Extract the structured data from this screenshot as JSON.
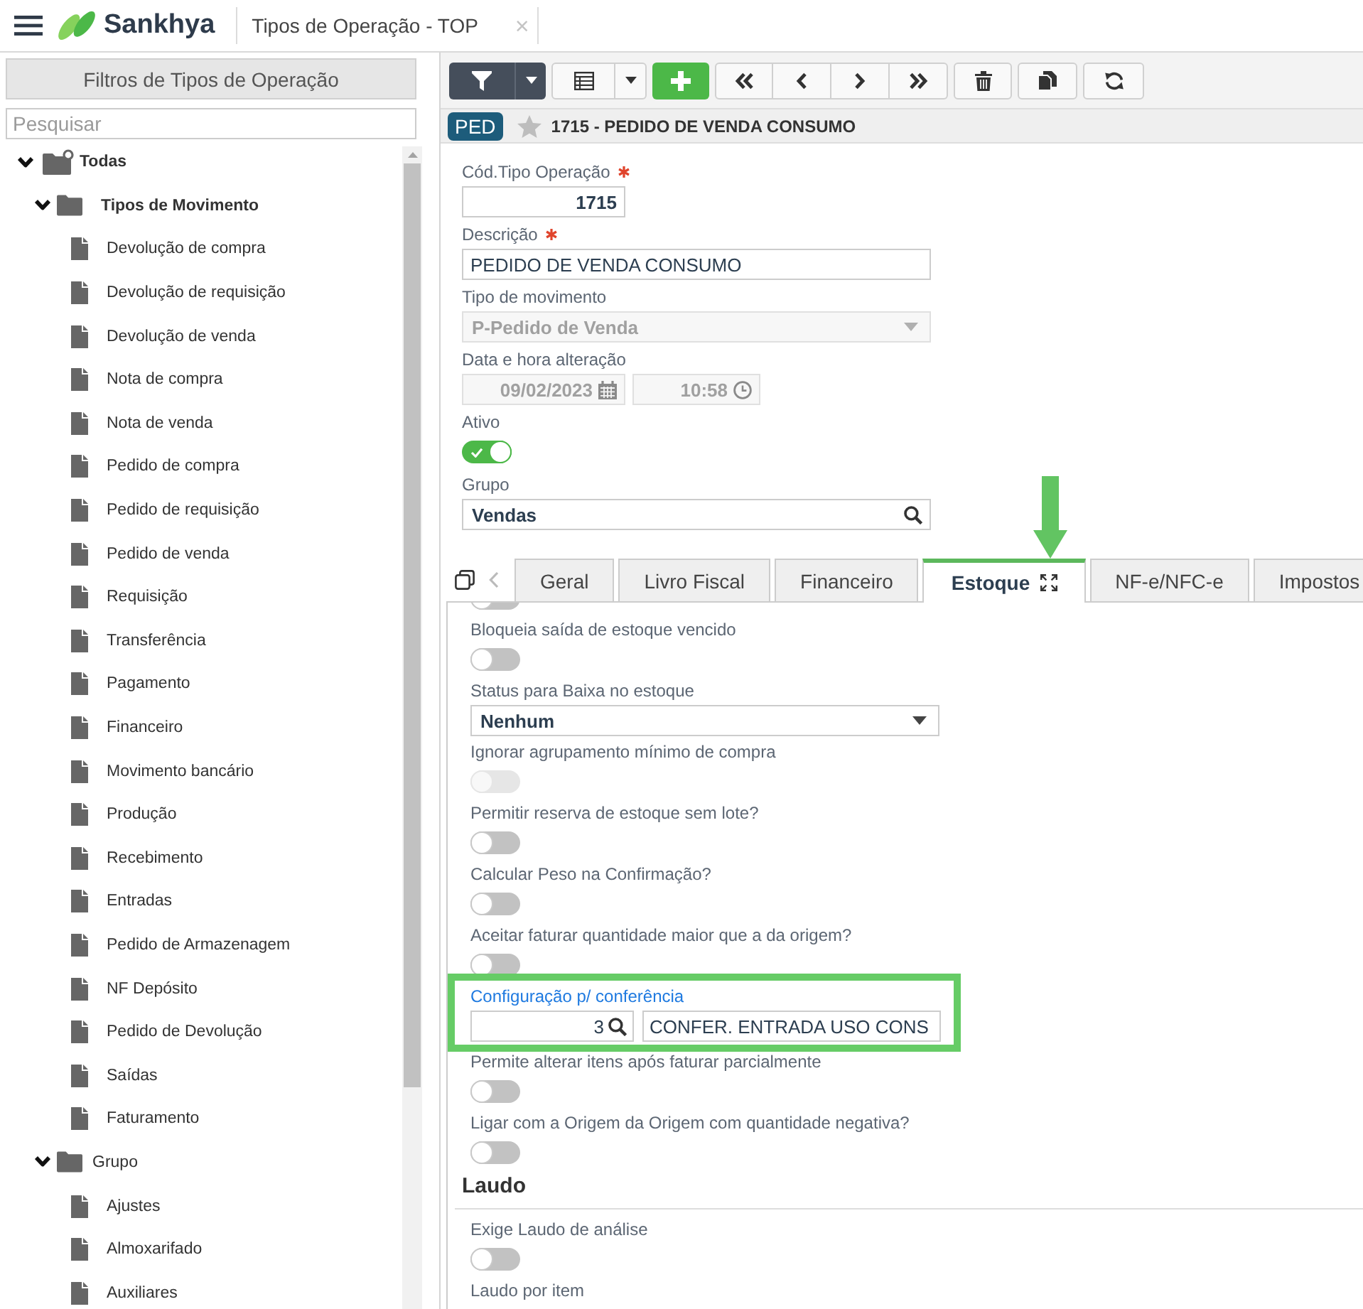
{
  "header": {
    "brand": "Sankhya",
    "tab_title": "Tipos de Operação - TOP",
    "close": "×"
  },
  "sidebar": {
    "title": "Filtros de Tipos de Operação",
    "search": {
      "placeholder": "Pesquisar"
    },
    "tree": [
      {
        "label": "Todas",
        "kind": "root",
        "expanded": true,
        "selected": false,
        "children": [
          {
            "label": "Tipos de Movimento",
            "kind": "folder",
            "expanded": true,
            "selected": true,
            "children": [
              {
                "label": "Devolução de compra",
                "kind": "file",
                "selected": false
              },
              {
                "label": "Devolução de requisição",
                "kind": "file",
                "selected": false
              },
              {
                "label": "Devolução de venda",
                "kind": "file",
                "selected": false
              },
              {
                "label": "Nota de compra",
                "kind": "file",
                "selected": false
              },
              {
                "label": "Nota de venda",
                "kind": "file",
                "selected": false
              },
              {
                "label": "Pedido de compra",
                "kind": "file",
                "selected": false
              },
              {
                "label": "Pedido de requisição",
                "kind": "file",
                "selected": false
              },
              {
                "label": "Pedido de venda",
                "kind": "file",
                "selected": false
              },
              {
                "label": "Requisição",
                "kind": "file",
                "selected": false
              },
              {
                "label": "Transferência",
                "kind": "file",
                "selected": false
              },
              {
                "label": "Pagamento",
                "kind": "file",
                "selected": false
              },
              {
                "label": "Financeiro",
                "kind": "file",
                "selected": false
              },
              {
                "label": "Movimento bancário",
                "kind": "file",
                "selected": false
              },
              {
                "label": "Produção",
                "kind": "file",
                "selected": false
              },
              {
                "label": "Recebimento",
                "kind": "file",
                "selected": false
              },
              {
                "label": "Entradas",
                "kind": "file",
                "selected": false
              },
              {
                "label": "Pedido de Armazenagem",
                "kind": "file",
                "selected": false
              },
              {
                "label": "NF Depósito",
                "kind": "file",
                "selected": false
              },
              {
                "label": "Pedido de Devolução",
                "kind": "file",
                "selected": false
              },
              {
                "label": "Saídas",
                "kind": "file",
                "selected": false
              },
              {
                "label": "Faturamento",
                "kind": "file",
                "selected": false
              }
            ]
          },
          {
            "label": "Grupo",
            "kind": "folder",
            "expanded": true,
            "selected": false,
            "children": [
              {
                "label": "Ajustes",
                "kind": "file",
                "selected": false
              },
              {
                "label": "Almoxarifado",
                "kind": "file",
                "selected": false
              },
              {
                "label": "Auxiliares",
                "kind": "file",
                "selected": false
              }
            ]
          }
        ]
      }
    ]
  },
  "record": {
    "badge": "PED",
    "favorite": false,
    "title": "1715 - PEDIDO DE VENDA CONSUMO"
  },
  "form": {
    "fields": [
      {
        "kind": "number",
        "label": "Cód.Tipo Operação",
        "required": true,
        "disabled": false,
        "value": "1715"
      },
      {
        "kind": "text",
        "label": "Descrição",
        "required": true,
        "disabled": false,
        "value": "PEDIDO DE VENDA CONSUMO"
      },
      {
        "kind": "select",
        "label": "Tipo de movimento",
        "required": false,
        "disabled": true,
        "value": "P-Pedido de Venda"
      },
      {
        "kind": "datetime",
        "label": "Data e hora alteração",
        "required": false,
        "disabled": true,
        "date": "09/02/2023",
        "time": "10:58"
      },
      {
        "kind": "toggle",
        "label": "Ativo",
        "required": false,
        "disabled": false,
        "on": true
      },
      {
        "kind": "lookup",
        "label": "Grupo",
        "required": false,
        "disabled": false,
        "value": "Vendas"
      }
    ]
  },
  "tabs": [
    {
      "label": "Geral",
      "selected": false,
      "pointer_arrow": false
    },
    {
      "label": "Livro Fiscal",
      "selected": false,
      "pointer_arrow": false
    },
    {
      "label": "Financeiro",
      "selected": false,
      "pointer_arrow": false
    },
    {
      "label": "Estoque",
      "selected": true,
      "pointer_arrow": true
    },
    {
      "label": "NF-e/NFC-e",
      "selected": false,
      "pointer_arrow": false
    },
    {
      "label": "Impostos",
      "selected": false,
      "pointer_arrow": false
    }
  ],
  "stock": {
    "fields": [
      {
        "kind": "toggle",
        "on": false,
        "disabled": false
      },
      {
        "kind": "toggle",
        "label": "Bloqueia saída de estoque vencido",
        "on": false,
        "disabled": false
      },
      {
        "kind": "select",
        "label": "Status para Baixa no estoque",
        "value": "Nenhum",
        "disabled": false
      },
      {
        "kind": "toggle",
        "label": "Ignorar agrupamento mínimo de compra",
        "on": false,
        "disabled": true
      },
      {
        "kind": "toggle",
        "label": "Permitir reserva de estoque sem lote?",
        "on": false,
        "disabled": false
      },
      {
        "kind": "toggle",
        "label": "Calcular Peso na Confirmação?",
        "on": false,
        "disabled": false
      },
      {
        "kind": "toggle",
        "label": "Aceitar faturar quantidade maior que a da origem?",
        "on": false,
        "disabled": false
      },
      {
        "kind": "lookup_pair",
        "label": "Configuração p/ conferência",
        "focused": true,
        "highlighted": true,
        "disabled": false,
        "code": "3",
        "description": "CONFER. ENTRADA USO CONS"
      },
      {
        "kind": "toggle",
        "label": "Permite alterar itens após faturar parcialmente",
        "on": false,
        "disabled": false
      },
      {
        "kind": "toggle",
        "label": "Ligar com a Origem da Origem com quantidade negativa?",
        "on": false,
        "disabled": false
      },
      {
        "kind": "section",
        "label": "Laudo"
      },
      {
        "kind": "toggle",
        "label": "Exige Laudo de análise",
        "on": false,
        "disabled": false
      },
      {
        "kind": "caption",
        "label": "Laudo por item"
      }
    ]
  }
}
